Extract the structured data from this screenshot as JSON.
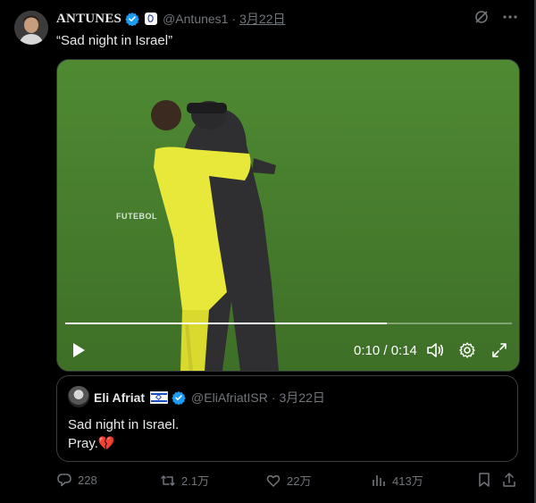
{
  "tweet": {
    "author_name": "ANTUNES",
    "handle": "@Antunes1",
    "separator": "·",
    "date": "3月22日",
    "text": "“Sad night in Israel”"
  },
  "video": {
    "watermark": "FUTEBOL",
    "progress": 0.72,
    "time_display": "0:10 / 0:14"
  },
  "quote": {
    "author_name": "Eli Afriat",
    "handle": "@EliAfriatISR",
    "separator": "·",
    "date": "3月22日",
    "line1": "Sad night in Israel.",
    "line2": "Pray.",
    "emoji": "💔"
  },
  "actions": {
    "replies": "228",
    "retweets": "2.1万",
    "likes": "22万",
    "views": "413万"
  },
  "colors": {
    "background": "#000000",
    "text": "#e7e9ea",
    "muted": "#71767b",
    "verified": "#1d9bf0",
    "pitch": "#4a7a2e"
  }
}
